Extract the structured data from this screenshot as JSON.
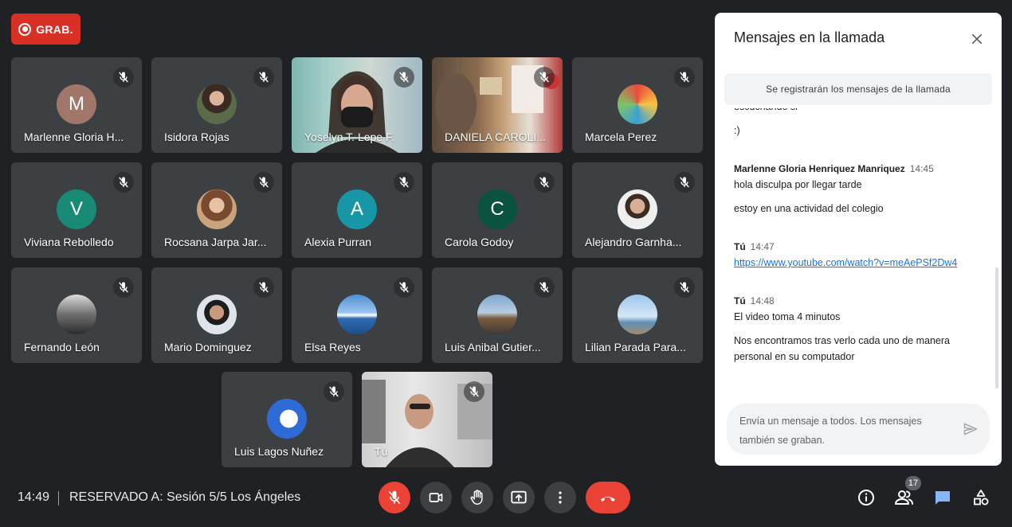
{
  "recording": {
    "label": "GRAB."
  },
  "participants": [
    {
      "name": "Marlenne Gloria H...",
      "avatar_letter": "M",
      "avatar_color": "#a1776b"
    },
    {
      "name": "Isidora Rojas"
    },
    {
      "name": "Yoselyn T. Lepe F."
    },
    {
      "name": "DANIELA CAROLI..."
    },
    {
      "name": "Marcela Perez"
    },
    {
      "name": "Viviana Rebolledo",
      "avatar_letter": "V",
      "avatar_color": "#188a75"
    },
    {
      "name": "Rocsana Jarpa Jar..."
    },
    {
      "name": "Alexia Purran",
      "avatar_letter": "A",
      "avatar_color": "#1797a6"
    },
    {
      "name": "Carola Godoy",
      "avatar_letter": "C",
      "avatar_color": "#0b5341"
    },
    {
      "name": "Alejandro Garnha..."
    },
    {
      "name": "Fernando León"
    },
    {
      "name": "Mario Dominguez"
    },
    {
      "name": "Elsa Reyes"
    },
    {
      "name": "Luis Anibal Gutier..."
    },
    {
      "name": "Lilian Parada Para..."
    },
    {
      "name": "Luis Lagos Nuñez"
    },
    {
      "name": "Tú"
    }
  ],
  "chat": {
    "title": "Mensajes en la llamada",
    "notice": "Se registrarán los mensajes de la llamada",
    "partial_text": "escuchando si",
    "messages": [
      {
        "text": ":)"
      },
      {
        "sender": "Marlenne Gloria Henriquez Manriquez",
        "time": "14:45",
        "lines": [
          "hola disculpa por llegar tarde",
          "estoy en una actividad del colegio"
        ]
      },
      {
        "sender": "Tú",
        "time": "14:47",
        "link": "https://www.youtube.com/watch?v=meAePSf2Dw4"
      },
      {
        "sender": "Tú",
        "time": "14:48",
        "lines": [
          "El video toma 4 minutos",
          "Nos encontramos tras verlo cada uno de manera personal en su computador"
        ]
      }
    ],
    "compose_placeholder": "Envía un mensaje a todos. Los mensajes también se graban."
  },
  "footer": {
    "time": "14:49",
    "meeting_name": "RESERVADO A: Sesión 5/5 Los Ángeles",
    "participant_count": "17"
  },
  "colors": {
    "accent_red": "#ea4335",
    "chat_blue": "#8ab4f8",
    "link": "#1a73e8"
  }
}
